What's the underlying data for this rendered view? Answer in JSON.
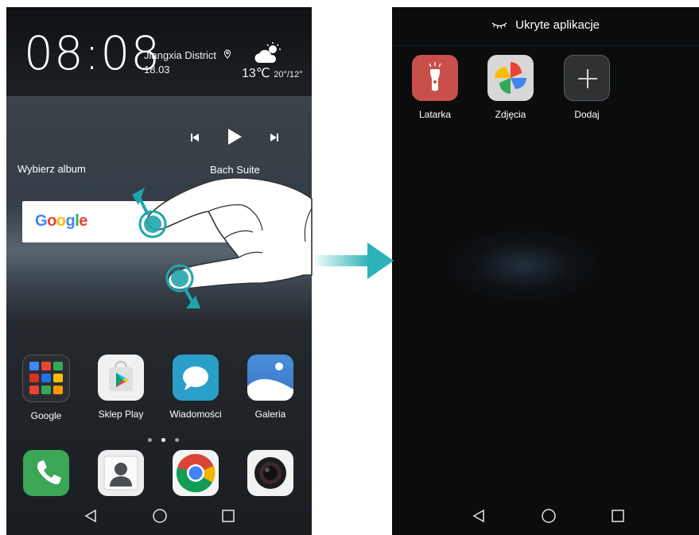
{
  "home_screen": {
    "clock": "08:08",
    "location": "Jiangxia District",
    "date": "18.03",
    "temperature": "13℃",
    "temp_range": "20°/12°",
    "weather_icon": "partly-cloudy-icon",
    "music": {
      "album_label": "Wybierz album",
      "song_label": "Bach Suite"
    },
    "search_widget": {
      "logo_text": "Google"
    },
    "apps": [
      {
        "label": "Google",
        "icon": "google-folder-icon"
      },
      {
        "label": "Sklep Play",
        "icon": "play-store-icon"
      },
      {
        "label": "Wiadomości",
        "icon": "messages-icon"
      },
      {
        "label": "Galeria",
        "icon": "gallery-icon"
      }
    ],
    "page_indicator": {
      "pages": 3,
      "current": 2
    },
    "dock": [
      "phone-icon",
      "contacts-icon",
      "chrome-icon",
      "camera-icon"
    ]
  },
  "hidden_apps_screen": {
    "title": "Ukryte aplikacje",
    "title_icon": "closed-eye-icon",
    "apps": [
      {
        "label": "Latarka",
        "icon": "flashlight-icon",
        "color": "#c9504a"
      },
      {
        "label": "Zdjęcia",
        "icon": "photos-icon",
        "color": "#d7d7d7"
      },
      {
        "label": "Dodaj",
        "icon": "add-icon",
        "color": "#2f3133"
      }
    ]
  },
  "colors": {
    "gesture_accent": "#1fa6ab",
    "arrow": "#2bb3b8"
  }
}
